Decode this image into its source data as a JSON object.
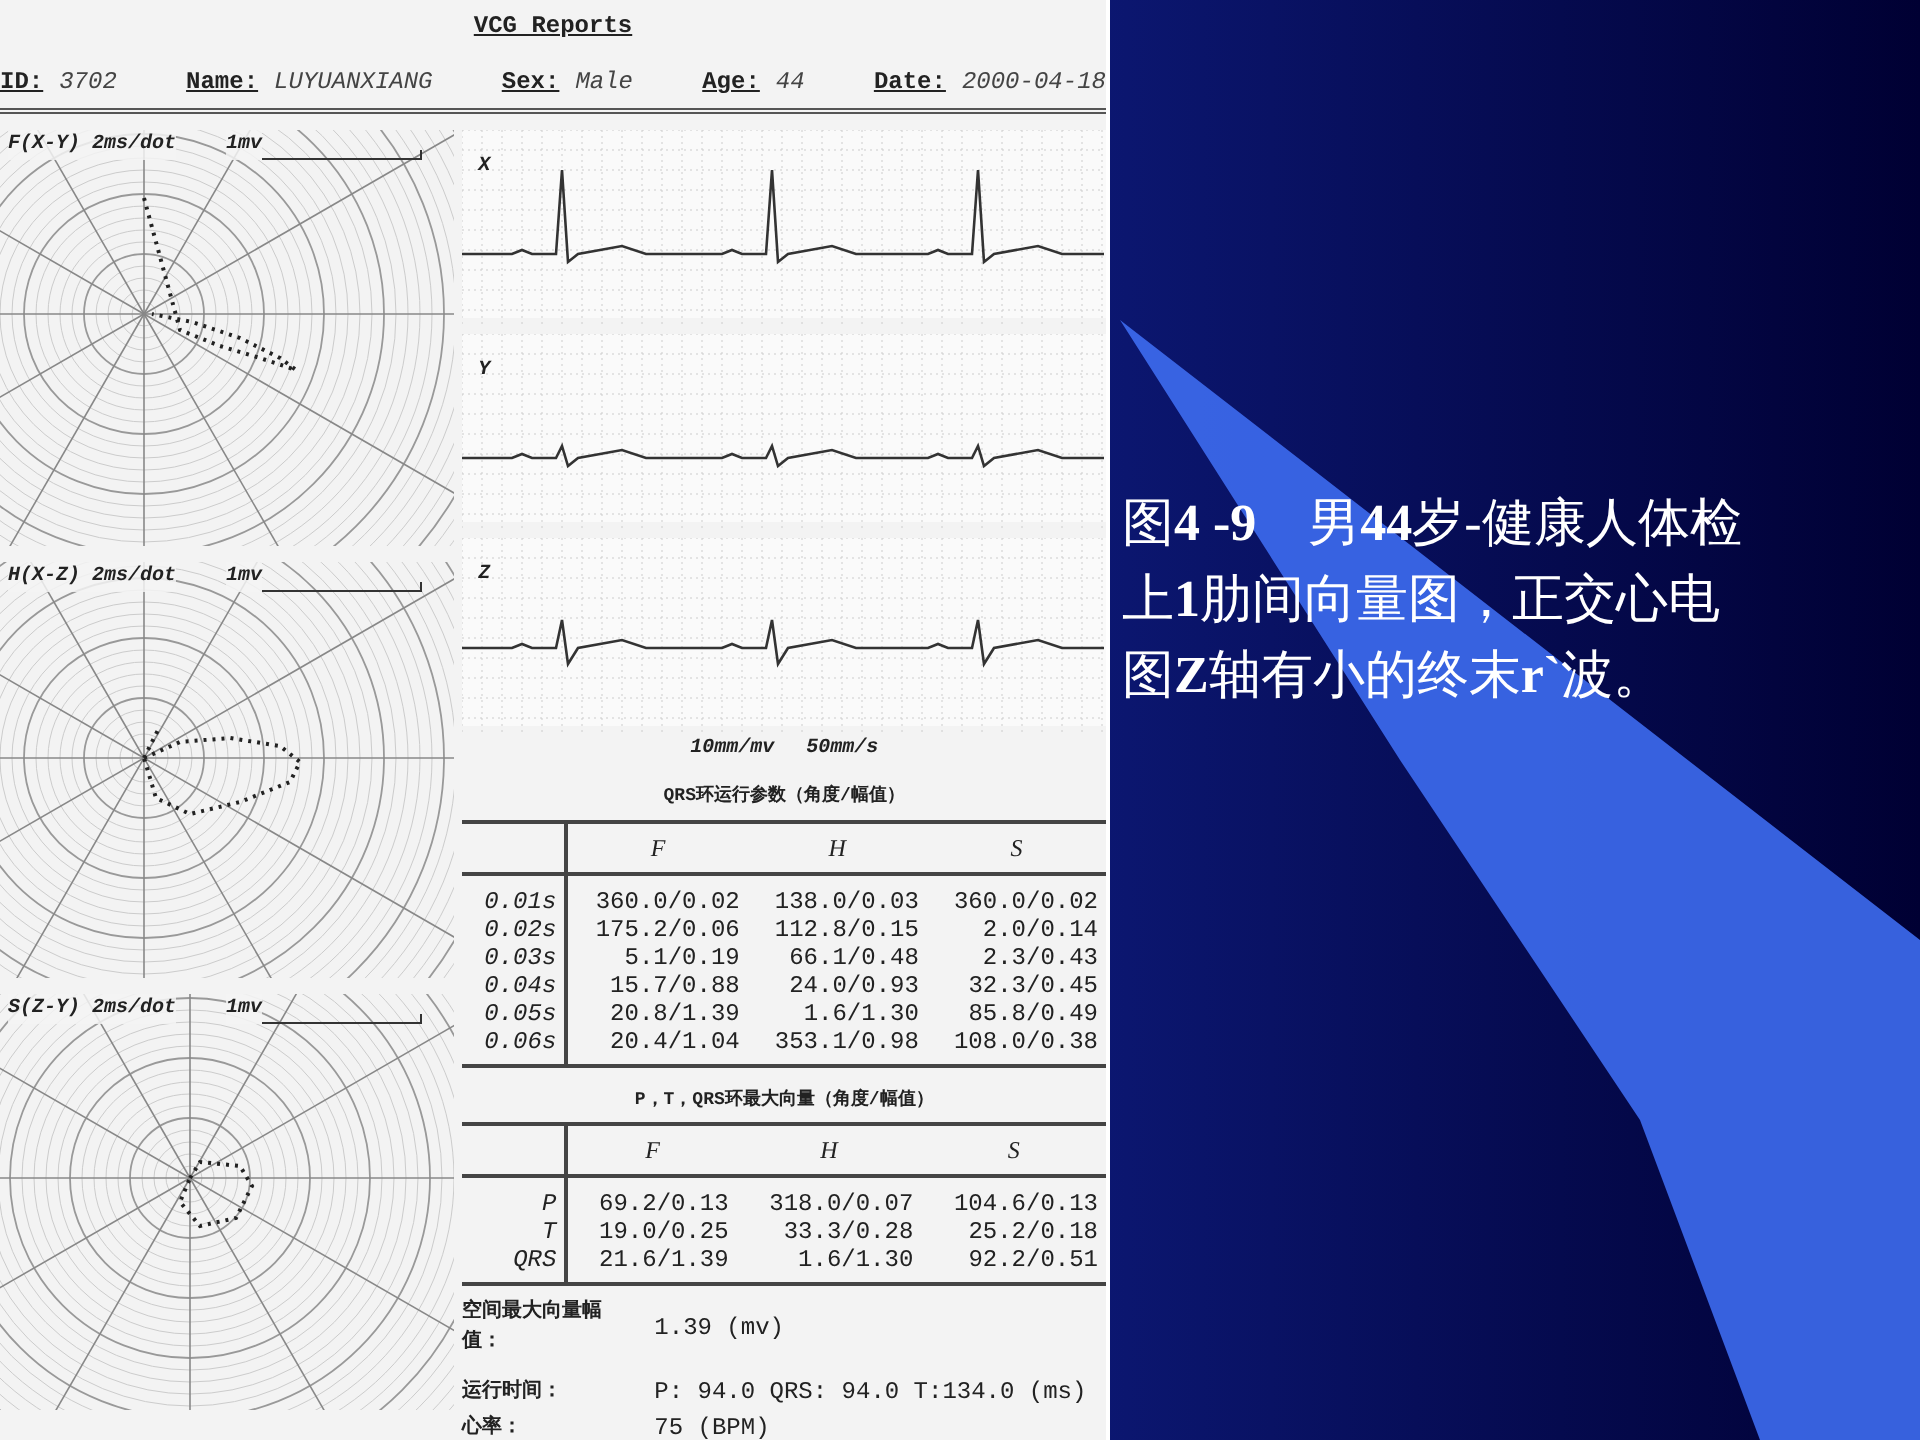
{
  "report": {
    "title": "VCG Reports",
    "header": [
      {
        "label": "ID:",
        "value": "3702"
      },
      {
        "label": "Name:",
        "value": "LUYUANXIANG"
      },
      {
        "label": "Sex:",
        "value": "Male"
      },
      {
        "label": "Age:",
        "value": "44"
      },
      {
        "label": "Date:",
        "value": "2000-04-18"
      }
    ],
    "loops": [
      {
        "label": "F(X-Y) 2ms/dot",
        "scale": "1mv"
      },
      {
        "label": "H(X-Z) 2ms/dot",
        "scale": "1mv"
      },
      {
        "label": "S(Z-Y) 2ms/dot",
        "scale": "1mv"
      }
    ],
    "leads": [
      {
        "label": "X"
      },
      {
        "label": "Y"
      },
      {
        "label": "Z"
      }
    ],
    "calibration": [
      "10mm/mv",
      "50mm/s"
    ],
    "qrs_table": {
      "title": "QRS环运行参数（角度/幅值）",
      "columns": [
        "F",
        "H",
        "S"
      ],
      "rows": [
        {
          "label": "0.01s",
          "cells": [
            "360.0/0.02",
            "138.0/0.03",
            "360.0/0.02"
          ]
        },
        {
          "label": "0.02s",
          "cells": [
            "175.2/0.06",
            "112.8/0.15",
            "2.0/0.14"
          ]
        },
        {
          "label": "0.03s",
          "cells": [
            "5.1/0.19",
            "66.1/0.48",
            "2.3/0.43"
          ]
        },
        {
          "label": "0.04s",
          "cells": [
            "15.7/0.88",
            "24.0/0.93",
            "32.3/0.45"
          ]
        },
        {
          "label": "0.05s",
          "cells": [
            "20.8/1.39",
            "1.6/1.30",
            "85.8/0.49"
          ]
        },
        {
          "label": "0.06s",
          "cells": [
            "20.4/1.04",
            "353.1/0.98",
            "108.0/0.38"
          ]
        }
      ]
    },
    "max_vector_table": {
      "title": "P，T，QRS环最大向量（角度/幅值）",
      "columns": [
        "F",
        "H",
        "S"
      ],
      "rows": [
        {
          "label": "P",
          "cells": [
            "69.2/0.13",
            "318.0/0.07",
            "104.6/0.13"
          ]
        },
        {
          "label": "T",
          "cells": [
            "19.0/0.25",
            "33.3/0.28",
            "25.2/0.18"
          ]
        },
        {
          "label": "QRS",
          "cells": [
            "21.6/1.39",
            "1.6/1.30",
            "92.2/0.51"
          ]
        }
      ]
    },
    "spatial_max": {
      "label": "空间最大向量幅值：",
      "value": "1.39 (mv)"
    },
    "durations": {
      "label": "运行时间：",
      "value": "P: 94.0  QRS: 94.0  T:134.0 (ms)"
    },
    "heart_rate": {
      "label": "心率：",
      "value": "75 (BPM)"
    }
  },
  "caption": [
    "图**4 -9**　男**44**岁-健康人体检",
    "上**1**肋间向量图，正交心电",
    "图**Z**轴有小的终末**r`**波。"
  ]
}
